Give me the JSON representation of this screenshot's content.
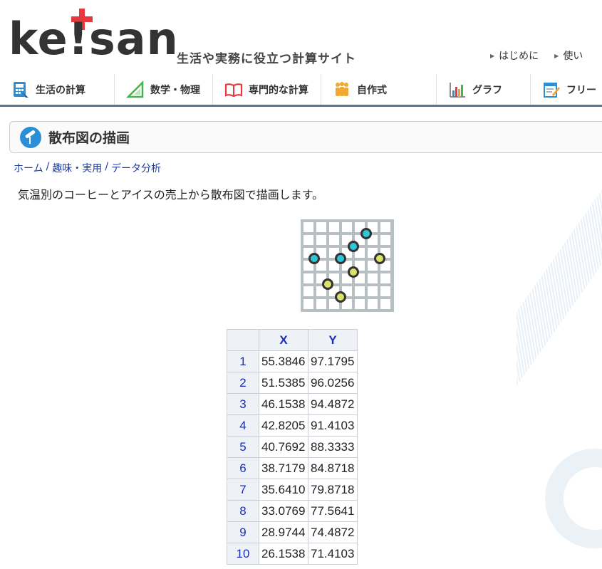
{
  "header": {
    "logo": "ke!san",
    "tagline": "生活や実務に役立つ計算サイト",
    "links": [
      "はじめに",
      "使い"
    ]
  },
  "nav": [
    {
      "label": "生活の計算",
      "icon": "calculator-icon"
    },
    {
      "label": "数学・物理",
      "icon": "ruler-triangle-icon"
    },
    {
      "label": "専門的な計算",
      "icon": "book-icon"
    },
    {
      "label": "自作式",
      "icon": "people-icon"
    },
    {
      "label": "グラフ",
      "icon": "bar-chart-icon"
    },
    {
      "label": "フリー",
      "icon": "notepad-icon"
    }
  ],
  "page": {
    "title": "散布図の描画",
    "breadcrumb": [
      "ホーム",
      "趣味・実用",
      "データ分析"
    ],
    "description": "気温別のコーヒーとアイスの売上から散布図で描画します。"
  },
  "table": {
    "headers": [
      "X",
      "Y"
    ],
    "rows": [
      {
        "n": "1",
        "x": "55.3846",
        "y": "97.1795"
      },
      {
        "n": "2",
        "x": "51.5385",
        "y": "96.0256"
      },
      {
        "n": "3",
        "x": "46.1538",
        "y": "94.4872"
      },
      {
        "n": "4",
        "x": "42.8205",
        "y": "91.4103"
      },
      {
        "n": "5",
        "x": "40.7692",
        "y": "88.3333"
      },
      {
        "n": "6",
        "x": "38.7179",
        "y": "84.8718"
      },
      {
        "n": "7",
        "x": "35.6410",
        "y": "79.8718"
      },
      {
        "n": "8",
        "x": "33.0769",
        "y": "77.5641"
      },
      {
        "n": "9",
        "x": "28.9744",
        "y": "74.4872"
      },
      {
        "n": "10",
        "x": "26.1538",
        "y": "71.4103"
      }
    ]
  },
  "colors": {
    "nav_border": "#5a7390",
    "logo_plus": "#e8383d",
    "link": "#1a3a9e",
    "dot_cyan": "#2fc6d8",
    "dot_yellow": "#d9e36a"
  }
}
